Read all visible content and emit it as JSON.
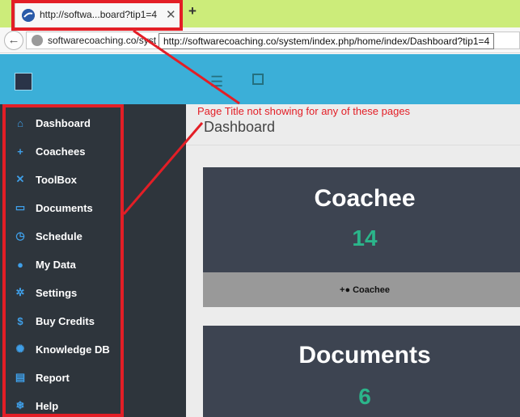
{
  "browser": {
    "tab_title": "http://softwa...board?tip1=4",
    "tab_close": "✕",
    "new_tab": "+",
    "back": "←",
    "url_display": "softwarecoaching.co/syst",
    "url_tooltip": "http://softwarecoaching.co/system/index.php/home/index/Dashboard?tip1=4"
  },
  "header": {
    "menu_icon": "hamburger-icon",
    "expand_icon": "fullscreen-icon"
  },
  "sidebar": {
    "items": [
      {
        "label": "Dashboard",
        "icon": "⌂"
      },
      {
        "label": "Coachees",
        "icon": "+"
      },
      {
        "label": "ToolBox",
        "icon": "✕"
      },
      {
        "label": "Documents",
        "icon": "▭"
      },
      {
        "label": "Schedule",
        "icon": "◷"
      },
      {
        "label": "My Data",
        "icon": "●"
      },
      {
        "label": "Settings",
        "icon": "✲"
      },
      {
        "label": "Buy Credits",
        "icon": "$"
      },
      {
        "label": "Knowledge DB",
        "icon": "✺"
      },
      {
        "label": "Report",
        "icon": "▤"
      },
      {
        "label": "Help",
        "icon": "❄"
      }
    ]
  },
  "main": {
    "page_title": "Dashboard",
    "cards": [
      {
        "title": "Coachee",
        "count": "14",
        "footer": "Coachee"
      },
      {
        "title": "Documents",
        "count": "6"
      }
    ]
  },
  "annotation": {
    "text": "Page Title not showing for any of these pages",
    "color": "#e31e26"
  },
  "colors": {
    "header": "#3bafd8",
    "sidebar": "#2e353c",
    "card": "#3d4451",
    "count": "#2bb58a",
    "tabbar": "#ccec7a"
  }
}
